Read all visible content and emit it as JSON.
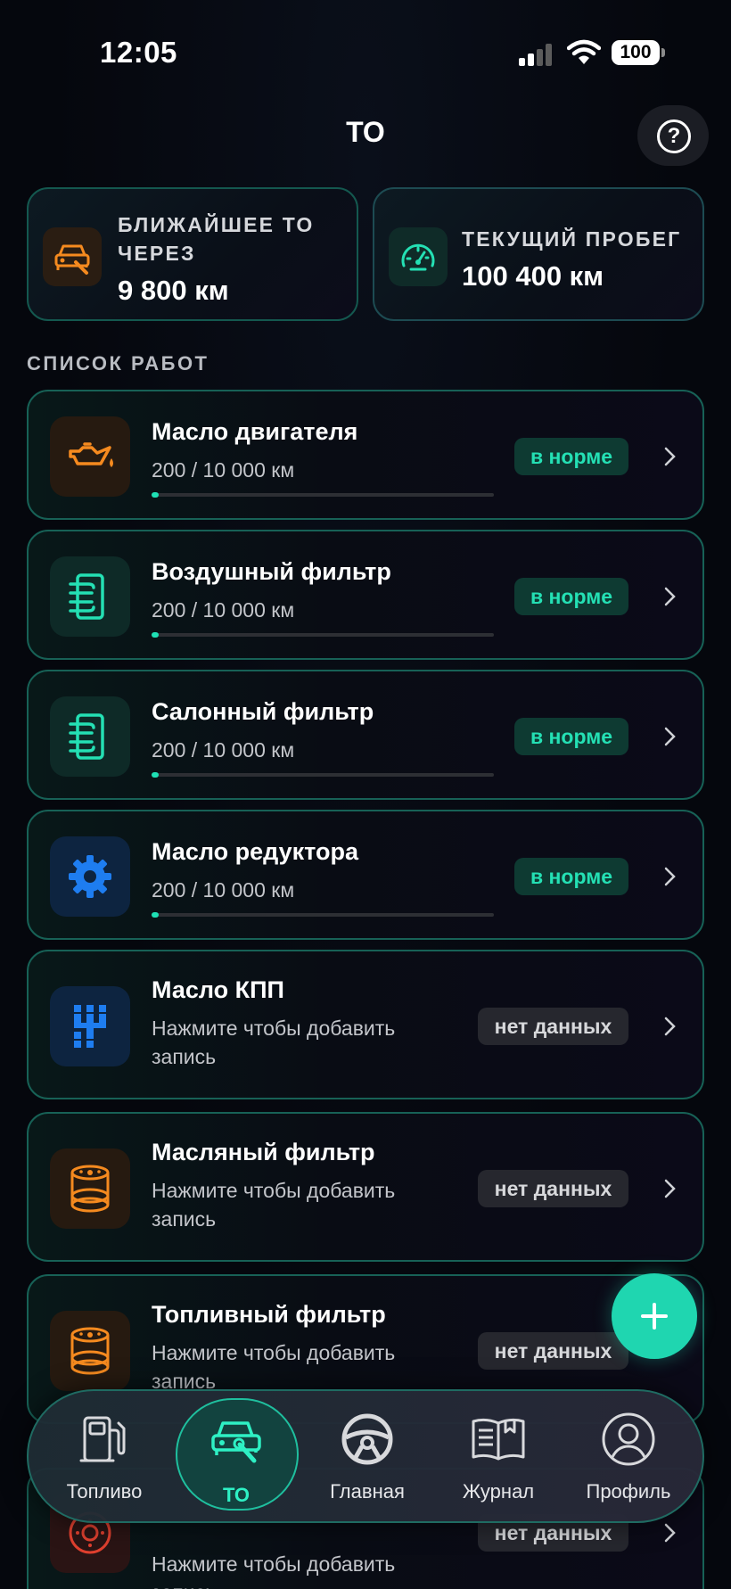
{
  "status_bar": {
    "time": "12:05",
    "battery": "100"
  },
  "header": {
    "title": "ТО"
  },
  "summary": {
    "next_service": {
      "label_line1": "БЛИЖАЙШЕЕ ТО",
      "label_line2": "ЧЕРЕЗ",
      "value": "9 800 км",
      "icon": "car-repair-icon"
    },
    "mileage": {
      "label": "ТЕКУЩИЙ ПРОБЕГ",
      "value": "100 400 км",
      "icon": "speedometer-icon"
    }
  },
  "section": {
    "title": "СПИСОК РАБОТ"
  },
  "works": [
    {
      "title": "Масло двигателя",
      "subtitle": "200 / 10 000 км",
      "status": "в норме",
      "progress": 0.02,
      "icon": "oil-can-icon"
    },
    {
      "title": "Воздушный фильтр",
      "subtitle": "200 / 10 000 км",
      "status": "в норме",
      "progress": 0.02,
      "icon": "air-filter-icon"
    },
    {
      "title": "Салонный фильтр",
      "subtitle": "200 / 10 000 км",
      "status": "в норме",
      "progress": 0.02,
      "icon": "cabin-filter-icon"
    },
    {
      "title": "Масло редуктора",
      "subtitle": "200 / 10 000 км",
      "status": "в норме",
      "progress": 0.02,
      "icon": "gear-icon"
    },
    {
      "title": "Масло КПП",
      "subtitle_line1": "Нажмите чтобы добавить",
      "subtitle_line2": "запись",
      "status": "нет данных",
      "icon": "gearbox-icon"
    },
    {
      "title": "Масляный фильтр",
      "subtitle_line1": "Нажмите чтобы добавить",
      "subtitle_line2": "запись",
      "status": "нет данных",
      "icon": "oil-filter-icon"
    },
    {
      "title": "Топливный фильтр",
      "subtitle_line1": "Нажмите чтобы добавить",
      "subtitle_line2": "запись",
      "status": "нет данных",
      "icon": "fuel-filter-icon"
    },
    {
      "subtitle_line1": "Нажмите чтобы добавить",
      "subtitle_line2": "запись",
      "status": "нет данных",
      "icon": "brake-disc-icon"
    }
  ],
  "nav": [
    {
      "label": "Топливо",
      "icon": "fuel-pump-icon"
    },
    {
      "label": "ТО",
      "icon": "car-repair-icon",
      "active": true
    },
    {
      "label": "Главная",
      "icon": "steering-wheel-icon"
    },
    {
      "label": "Журнал",
      "icon": "book-icon"
    },
    {
      "label": "Профиль",
      "icon": "profile-icon"
    }
  ],
  "colors": {
    "accent": "#1fd6b0",
    "orange": "#f58a1f",
    "blue": "#1e7df0",
    "red": "#e0402f"
  }
}
